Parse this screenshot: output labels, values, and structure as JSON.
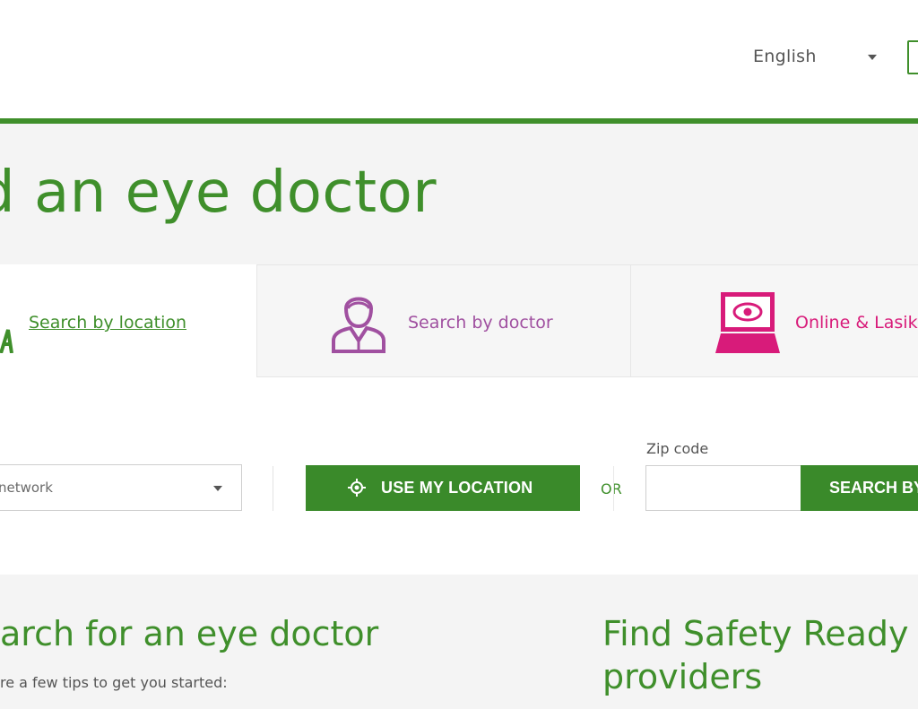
{
  "header": {
    "language": "English"
  },
  "hero": {
    "title": "d an eye doctor"
  },
  "tabs": [
    {
      "label": "Search by location",
      "color": "#3f8f2b",
      "icon": "location-icon",
      "active": true
    },
    {
      "label": "Search by doctor",
      "color": "#a050a0",
      "icon": "doctor-icon",
      "active": false
    },
    {
      "label": "Online & Lasik",
      "color": "#d81b7a",
      "icon": "laptop-eye-icon",
      "active": false
    }
  ],
  "search": {
    "network_select_value": "network",
    "use_location_label": "USE MY LOCATION",
    "or_label": "OR",
    "zip_label": "Zip code",
    "zip_value": "",
    "search_button_label": "SEARCH BY ZIP"
  },
  "cards": [
    {
      "title": "arch for an eye doctor",
      "text": "re a few tips to get you started:"
    },
    {
      "title_line1": "Find Safety Ready",
      "title_line2": "providers"
    }
  ],
  "colors": {
    "brand_green": "#3f8f2b",
    "doctor_purple": "#a050a0",
    "online_pink": "#d81b7a"
  }
}
